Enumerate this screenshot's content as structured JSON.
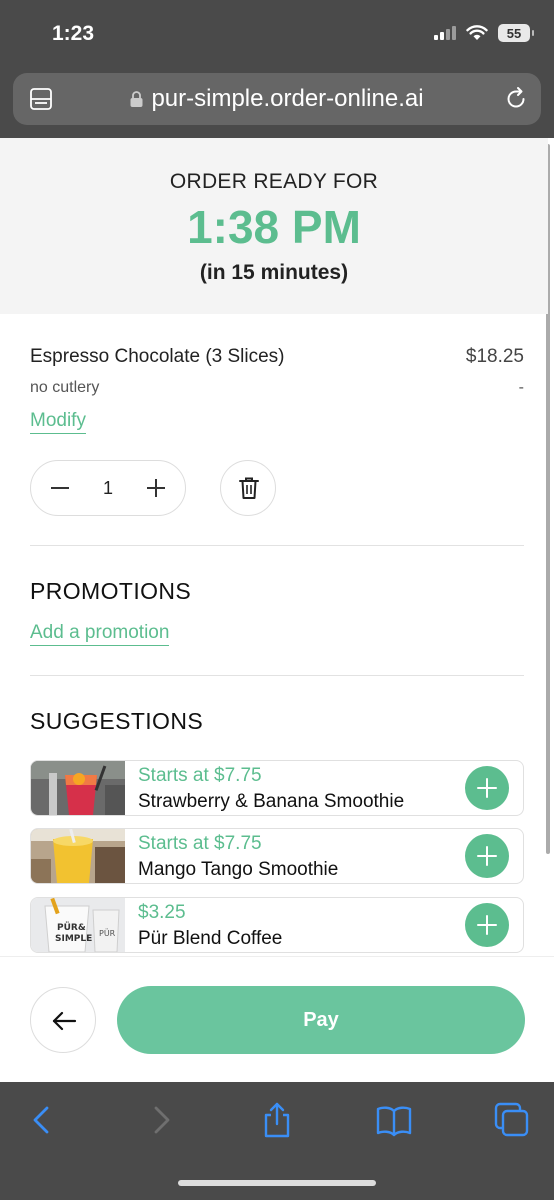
{
  "status_bar": {
    "time": "1:23",
    "battery": "55"
  },
  "browser": {
    "url": "pur-simple.order-online.ai"
  },
  "order": {
    "ready_label": "ORDER READY FOR",
    "ready_time": "1:38 PM",
    "ready_eta": "(in 15 minutes)"
  },
  "cart_item": {
    "name": "Espresso Chocolate (3 Slices)",
    "price": "$18.25",
    "note": "no cutlery",
    "note_price": "-",
    "modify_label": "Modify",
    "quantity": "1"
  },
  "promotions": {
    "title": "PROMOTIONS",
    "add_label": "Add a promotion"
  },
  "suggestions": {
    "title": "SUGGESTIONS",
    "items": [
      {
        "price": "Starts at $7.75",
        "name": "Strawberry & Banana Smoothie"
      },
      {
        "price": "Starts at $7.75",
        "name": "Mango Tango Smoothie"
      },
      {
        "price": "$3.25",
        "name": "Pür Blend Coffee"
      }
    ]
  },
  "footer": {
    "pay_label": "Pay"
  },
  "colors": {
    "accent": "#5cbd8f",
    "pay_button": "#6ac59e",
    "chrome": "#4a4a4a",
    "ios_blue": "#3a8ef6"
  },
  "icons": {
    "status": [
      "signal-icon",
      "wifi-icon",
      "battery-icon"
    ],
    "browser": [
      "reader-mode-icon",
      "lock-icon",
      "reload-icon"
    ],
    "toolbar": [
      "back-chevron-icon",
      "forward-chevron-icon",
      "share-icon",
      "bookmarks-icon",
      "tabs-icon"
    ]
  }
}
